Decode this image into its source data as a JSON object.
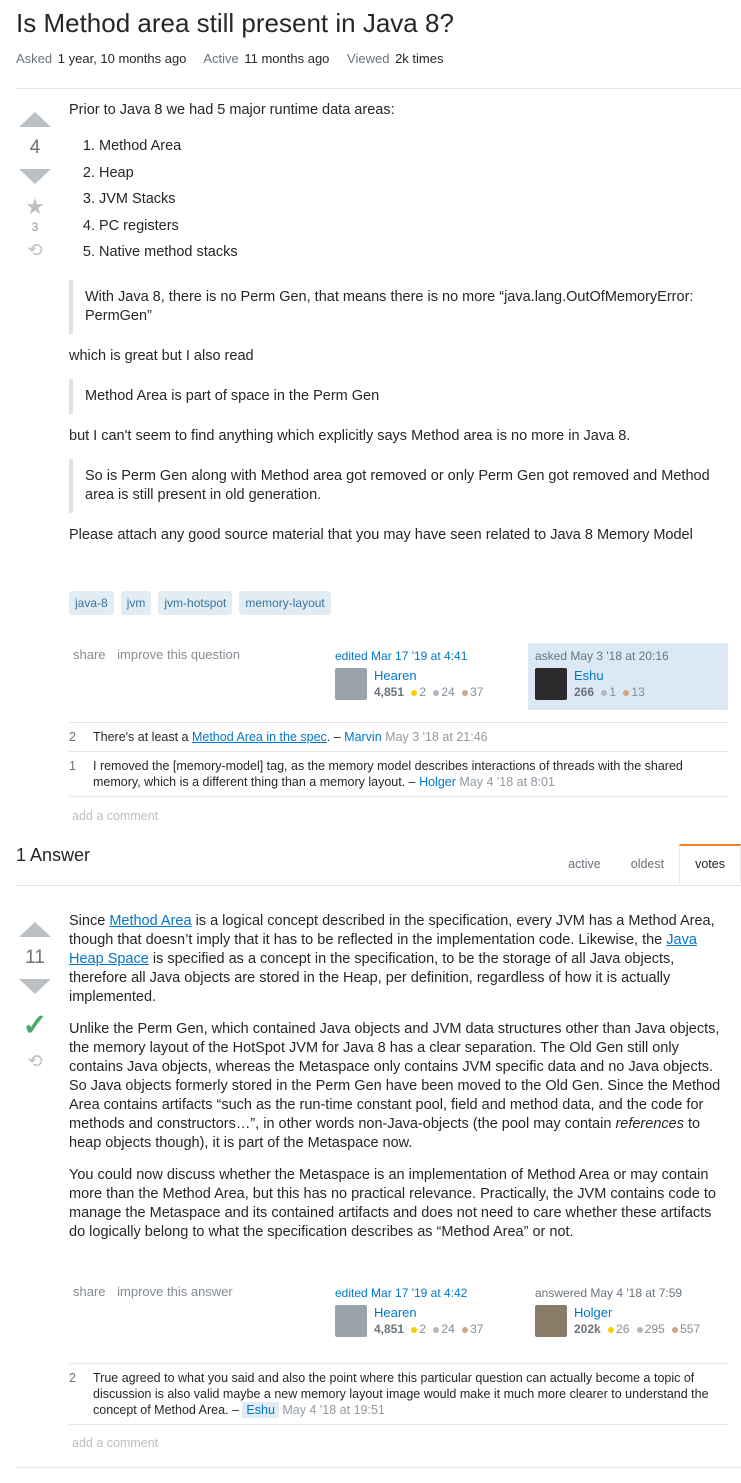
{
  "question": {
    "title": "Is Method area still present in Java 8?",
    "meta": {
      "asked_label": "Asked",
      "asked_value": "1 year, 10 months ago",
      "active_label": "Active",
      "active_value": "11 months ago",
      "viewed_label": "Viewed",
      "viewed_value": "2k times"
    },
    "votes": "4",
    "favorites": "3",
    "body": {
      "intro": "Prior to Java 8 we had 5 major runtime data areas:",
      "list": [
        "Method Area",
        "Heap",
        "JVM Stacks",
        "PC registers",
        "Native method stacks"
      ],
      "quote1": "With Java 8, there is no Perm Gen, that means there is no more “java.lang.OutOfMemoryError: PermGen”",
      "p2": "which is great but I also read",
      "quote2": "Method Area is part of space in the Perm Gen",
      "p3": "but I can't seem to find anything which explicitly says Method area is no more in Java 8.",
      "quote3": "So is Perm Gen along with Method area got removed or only Perm Gen got removed and Method area is still present in old generation.",
      "p4": "Please attach any good source material that you may have seen related to Java 8 Memory Model"
    },
    "tags": [
      "java-8",
      "jvm",
      "jvm-hotspot",
      "memory-layout"
    ],
    "menu": {
      "share": "share",
      "improve": "improve this question"
    },
    "edited": {
      "label": "edited Mar 17 '19 at 4:41",
      "user": "Hearen",
      "rep": "4,851",
      "gold": "2",
      "silver": "24",
      "bronze": "37"
    },
    "asked": {
      "label": "asked May 3 '18 at 20:16",
      "user": "Eshu",
      "rep": "266",
      "silver": "1",
      "bronze": "13"
    },
    "comments": [
      {
        "score": "2",
        "pre": "There's at least a ",
        "link": "Method Area in the spec",
        "post": ". – ",
        "user": "Marvin",
        "date": "May 3 '18 at 21:46"
      },
      {
        "score": "1",
        "pre": "I removed the [memory-model] tag, as the memory model describes interactions of threads with the shared memory, which is a different thing than a memory layout. – ",
        "link": "",
        "post": "",
        "user": "Holger",
        "date": "May 4 '18 at 8:01"
      }
    ],
    "add_comment": "add a comment"
  },
  "answers_header": {
    "count_label": "1 Answer",
    "tabs": [
      "active",
      "oldest",
      "votes"
    ]
  },
  "answer": {
    "votes": "11",
    "p1": {
      "a": "Since ",
      "link1": "Method Area",
      "b": " is a logical concept described in the specification, every JVM has a Method Area, though that doesn’t imply that it has to be reflected in the implementation code. Likewise, the ",
      "link2": "Java Heap Space",
      "c": " is specified as a concept in the specification, to be the storage of all Java objects, therefore all Java objects are stored in the Heap, per definition, regardless of how it is actually implemented."
    },
    "p2": {
      "a": "Unlike the Perm Gen, which contained Java objects and JVM data structures other than Java objects, the memory layout of the HotSpot JVM for Java 8 has a clear separation. The Old Gen still only contains Java objects, whereas the Metaspace only contains JVM specific data and no Java objects. So Java objects formerly stored in the Perm Gen have been moved to the Old Gen. Since the Method Area contains artifacts “such as the run-time constant pool, field and method data, and the code for methods and constructors…”, in other words non-Java-objects (the pool may contain ",
      "em": "references",
      "b": " to heap objects though), it is part of the Metaspace now."
    },
    "p3": "You could now discuss whether the Metaspace is an implementation of Method Area or may contain more than the Method Area, but this has no practical relevance. Practically, the JVM contains code to manage the Metaspace and its contained artifacts and does not need to care whether these artifacts do logically belong to what the specification describes as “Method Area” or not.",
    "menu": {
      "share": "share",
      "improve": "improve this answer"
    },
    "edited": {
      "label": "edited Mar 17 '19 at 4:42",
      "user": "Hearen",
      "rep": "4,851",
      "gold": "2",
      "silver": "24",
      "bronze": "37"
    },
    "answered": {
      "label": "answered May 4 '18 at 7:59",
      "user": "Holger",
      "rep": "202k",
      "gold": "26",
      "silver": "295",
      "bronze": "557"
    },
    "comments": [
      {
        "score": "2",
        "text": "True agreed to what you said and also the point where this particular question can actually become a topic of discussion is also valid maybe a new memory layout image would make it much more clearer to understand the concept of Method Area. – ",
        "user": "Eshu",
        "date": "May 4 '18 at 19:51"
      }
    ],
    "add_comment": "add a comment"
  }
}
